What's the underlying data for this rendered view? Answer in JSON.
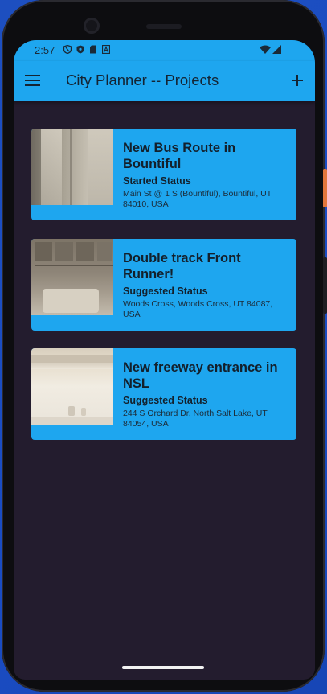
{
  "status_bar": {
    "time": "2:57",
    "left_icons": [
      "vpn-shield-icon",
      "shield-icon",
      "sd-card-icon",
      "a-icon"
    ],
    "right_icons": [
      "wifi-icon",
      "signal-icon"
    ]
  },
  "app_bar": {
    "title": "City Planner -- Projects",
    "menu_icon": "hamburger-menu-icon",
    "add_icon": "plus-icon"
  },
  "projects": [
    {
      "title": "New Bus Route in Bountiful",
      "status": "Started Status",
      "address": "Main St @ 1 S (Bountiful), Bountiful, UT 84010, USA"
    },
    {
      "title": "Double track Front Runner!",
      "status": "Suggested Status",
      "address": "Woods Cross, Woods Cross, UT 84087, USA"
    },
    {
      "title": "New freeway entrance in NSL",
      "status": "Suggested Status",
      "address": "244 S Orchard Dr, North Salt Lake, UT 84054, USA"
    }
  ],
  "colors": {
    "accent": "#1ea6ef",
    "background": "#231c2e",
    "text": "#142433"
  }
}
